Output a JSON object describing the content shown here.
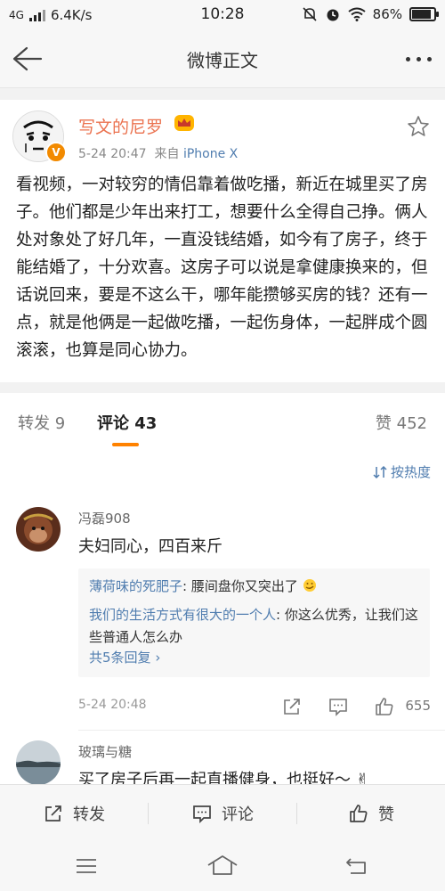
{
  "status_bar": {
    "network": "4G",
    "speed": "6.4K/s",
    "time": "10:28",
    "battery": "86%",
    "battery_level": 0.86
  },
  "nav": {
    "title": "微博正文"
  },
  "post": {
    "author": "写文的尼罗",
    "time": "5-24 20:47",
    "from_label": "来自",
    "source": "iPhone X",
    "text": "看视频，一对较穷的情侣靠着做吃播，新近在城里买了房子。他们都是少年出来打工，想要什么全得自己挣。俩人处对象处了好几年，一直没钱结婚，如今有了房子，终于能结婚了，十分欢喜。这房子可以说是拿健康换来的，但话说回来，要是不这么干，哪年能攒够买房的钱？还有一点，就是他俩是一起做吃播，一起伤身体，一起胖成个圆滚滚，也算是同心协力。"
  },
  "tabs": {
    "forward": "转发 9",
    "comment": "评论 43",
    "like": "赞 452"
  },
  "sort": {
    "label": "按热度"
  },
  "comments": [
    {
      "name": "冯磊908",
      "text": "夫妇同心，四百来斤",
      "replies": [
        {
          "name": "薄荷味的死肥子",
          "text": "腰间盘你又突出了"
        },
        {
          "name": "我们的生活方式有很大的一个人",
          "text": "你这么优秀，让我们这些普通人怎么办"
        }
      ],
      "more_replies": "共5条回复",
      "time": "5-24 20:48",
      "likes": "655"
    },
    {
      "name": "玻璃与糖",
      "text": "买了房子后再一起直播健身，也挺好～"
    }
  ],
  "actions": {
    "forward": "转发",
    "comment": "评论",
    "like": "赞"
  },
  "icons": [
    "back-arrow-icon",
    "more-icon",
    "favorite-star-icon",
    "sort-icon",
    "share-icon",
    "comment-icon",
    "like-icon",
    "menu-icon",
    "home-icon",
    "return-icon"
  ],
  "colors": {
    "accent": "#ff8200",
    "author": "#eb7350",
    "link": "#507daf"
  }
}
